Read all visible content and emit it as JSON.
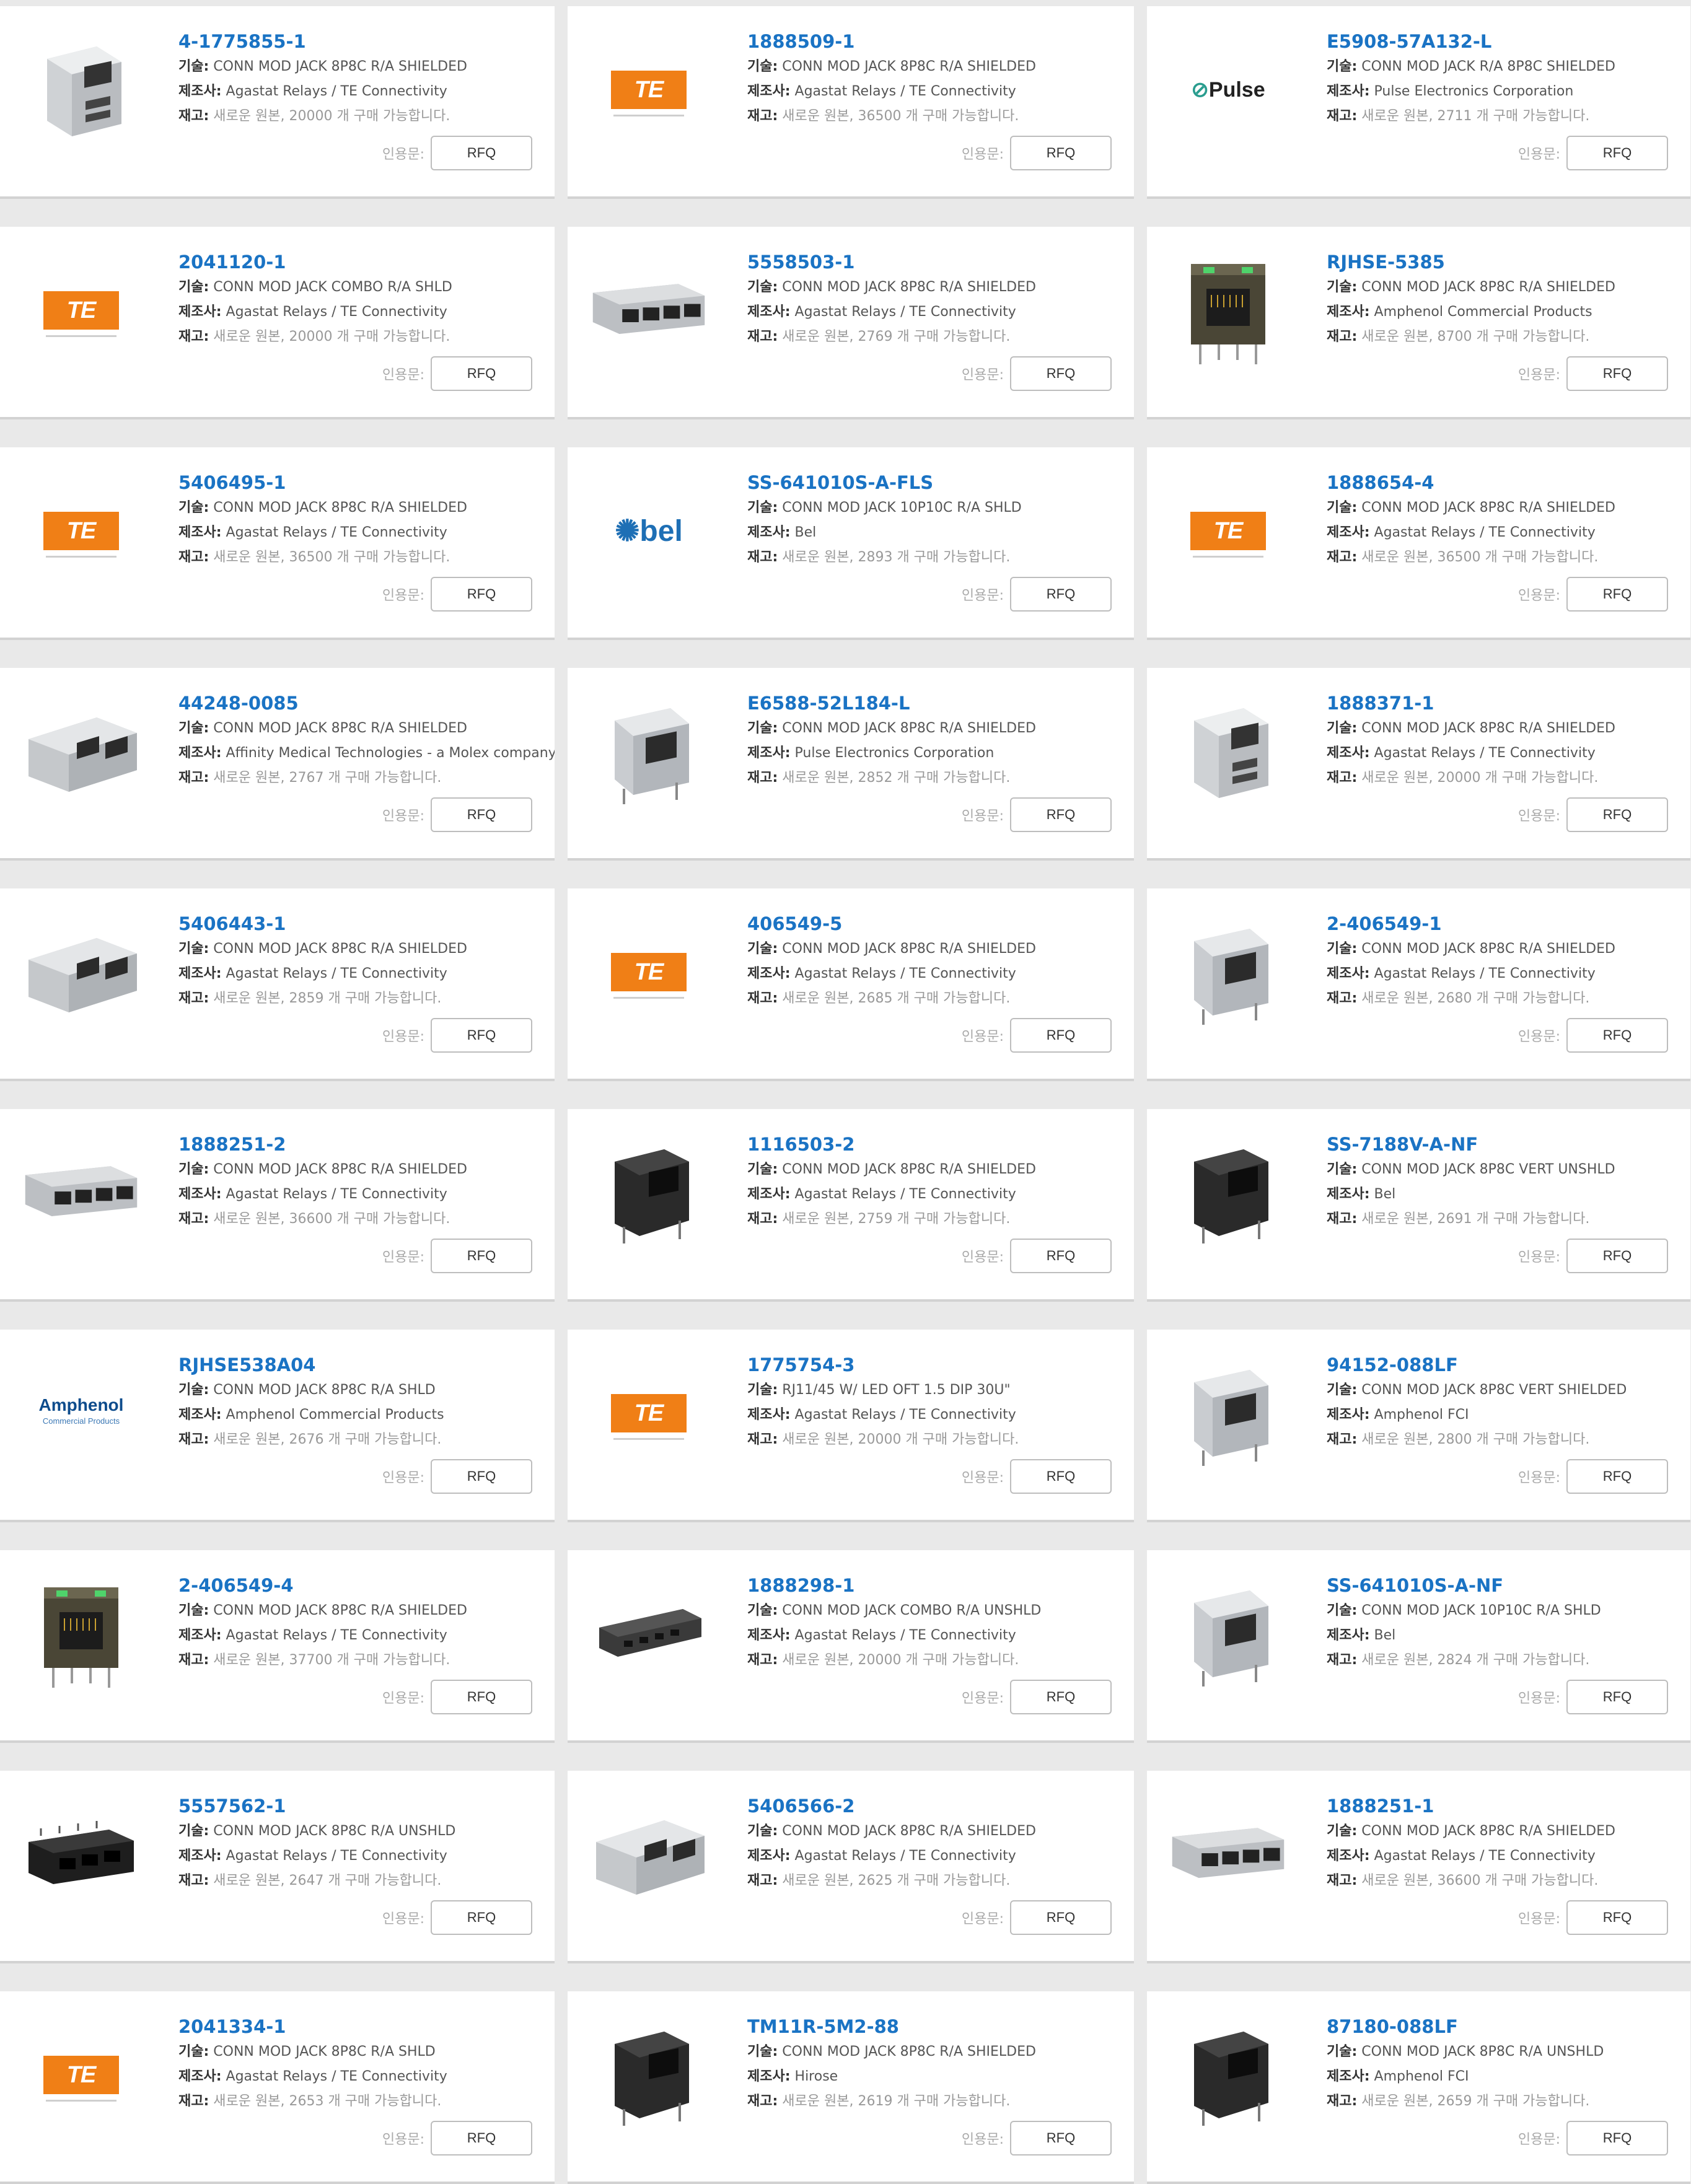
{
  "labels": {
    "desc": "기술:",
    "mfr": "제조사:",
    "stock": "재고:",
    "quote": "인용문:",
    "rfq": "RFQ"
  },
  "products": [
    {
      "pn": "4-1775855-1",
      "desc": "CONN MOD JACK 8P8C R/A SHIELDED",
      "mfr": "Agastat Relays / TE Connectivity",
      "stock": "새로운 원본, 20000 개 구매 가능합니다.",
      "image": "silver-jack-usb-image"
    },
    {
      "pn": "1888509-1",
      "desc": "CONN MOD JACK 8P8C R/A SHIELDED",
      "mfr": "Agastat Relays / TE Connectivity",
      "stock": "새로운 원본, 36500 개 구매 가능합니다.",
      "image": "te-logo"
    },
    {
      "pn": "E5908-57A132-L",
      "desc": "CONN MOD JACK R/A 8P8C SHIELDED",
      "mfr": "Pulse Electronics Corporation",
      "stock": "새로운 원본, 2711 개 구매 가능합니다.",
      "image": "pulse-logo"
    },
    {
      "pn": "2041120-1",
      "desc": "CONN MOD JACK COMBO R/A SHLD",
      "mfr": "Agastat Relays / TE Connectivity",
      "stock": "새로운 원본, 20000 개 구매 가능합니다.",
      "image": "te-logo"
    },
    {
      "pn": "5558503-1",
      "desc": "CONN MOD JACK 8P8C R/A SHIELDED",
      "mfr": "Agastat Relays / TE Connectivity",
      "stock": "새로운 원본, 2769 개 구매 가능합니다.",
      "image": "quad-jack-image"
    },
    {
      "pn": "RJHSE-5385",
      "desc": "CONN MOD JACK 8P8C R/A SHIELDED",
      "mfr": "Amphenol Commercial Products",
      "stock": "새로운 원본, 8700 개 구매 가능합니다.",
      "image": "dark-jack-led-image"
    },
    {
      "pn": "5406495-1",
      "desc": "CONN MOD JACK 8P8C R/A SHIELDED",
      "mfr": "Agastat Relays / TE Connectivity",
      "stock": "새로운 원본, 36500 개 구매 가능합니다.",
      "image": "te-logo"
    },
    {
      "pn": "SS-641010S-A-FLS",
      "desc": "CONN MOD JACK 10P10C R/A SHLD",
      "mfr": "Bel",
      "stock": "새로운 원본, 2893 개 구매 가능합니다.",
      "image": "bel-logo"
    },
    {
      "pn": "1888654-4",
      "desc": "CONN MOD JACK 8P8C R/A SHIELDED",
      "mfr": "Agastat Relays / TE Connectivity",
      "stock": "새로운 원본, 36500 개 구매 가능합니다.",
      "image": "te-logo"
    },
    {
      "pn": "44248-0085",
      "desc": "CONN MOD JACK 8P8C R/A SHIELDED",
      "mfr": "Affinity Medical Technologies - a Molex company",
      "stock": "새로운 원본, 2767 개 구매 가능합니다.",
      "image": "dual-jack-image"
    },
    {
      "pn": "E6588-52L184-L",
      "desc": "CONN MOD JACK 8P8C R/A SHIELDED",
      "mfr": "Pulse Electronics Corporation",
      "stock": "새로운 원본, 2852 개 구매 가능합니다.",
      "image": "silver-jack-image"
    },
    {
      "pn": "1888371-1",
      "desc": "CONN MOD JACK 8P8C R/A SHIELDED",
      "mfr": "Agastat Relays / TE Connectivity",
      "stock": "새로운 원본, 20000 개 구매 가능합니다.",
      "image": "silver-jack-usb-image"
    },
    {
      "pn": "5406443-1",
      "desc": "CONN MOD JACK 8P8C R/A SHIELDED",
      "mfr": "Agastat Relays / TE Connectivity",
      "stock": "새로운 원본, 2859 개 구매 가능합니다.",
      "image": "dual-jack-image"
    },
    {
      "pn": "406549-5",
      "desc": "CONN MOD JACK 8P8C R/A SHIELDED",
      "mfr": "Agastat Relays / TE Connectivity",
      "stock": "새로운 원본, 2685 개 구매 가능합니다.",
      "image": "te-logo"
    },
    {
      "pn": "2-406549-1",
      "desc": "CONN MOD JACK 8P8C R/A SHIELDED",
      "mfr": "Agastat Relays / TE Connectivity",
      "stock": "새로운 원본, 2680 개 구매 가능합니다.",
      "image": "silver-jack-image"
    },
    {
      "pn": "1888251-2",
      "desc": "CONN MOD JACK 8P8C R/A SHIELDED",
      "mfr": "Agastat Relays / TE Connectivity",
      "stock": "새로운 원본, 36600 개 구매 가능합니다.",
      "image": "quad-jack-image"
    },
    {
      "pn": "1116503-2",
      "desc": "CONN MOD JACK 8P8C R/A SHIELDED",
      "mfr": "Agastat Relays / TE Connectivity",
      "stock": "새로운 원본, 2759 개 구매 가능합니다.",
      "image": "black-jack-image"
    },
    {
      "pn": "SS-7188V-A-NF",
      "desc": "CONN MOD JACK 8P8C VERT UNSHLD",
      "mfr": "Bel",
      "stock": "새로운 원본, 2691 개 구매 가능합니다.",
      "image": "black-jack-image"
    },
    {
      "pn": "RJHSE538A04",
      "desc": "CONN MOD JACK 8P8C R/A SHLD",
      "mfr": "Amphenol Commercial Products",
      "stock": "새로운 원본, 2676 개 구매 가능합니다.",
      "image": "amphenol-logo"
    },
    {
      "pn": "1775754-3",
      "desc": "RJ11/45 W/ LED OFT 1.5 DIP 30U\"",
      "mfr": "Agastat Relays / TE Connectivity",
      "stock": "새로운 원본, 20000 개 구매 가능합니다.",
      "image": "te-logo"
    },
    {
      "pn": "94152-088LF",
      "desc": "CONN MOD JACK 8P8C VERT SHIELDED",
      "mfr": "Amphenol FCI",
      "stock": "새로운 원본, 2800 개 구매 가능합니다.",
      "image": "silver-jack-image"
    },
    {
      "pn": "2-406549-4",
      "desc": "CONN MOD JACK 8P8C R/A SHIELDED",
      "mfr": "Agastat Relays / TE Connectivity",
      "stock": "새로운 원본, 37700 개 구매 가능합니다.",
      "image": "dark-jack-led-image"
    },
    {
      "pn": "1888298-1",
      "desc": "CONN MOD JACK COMBO R/A UNSHLD",
      "mfr": "Agastat Relays / TE Connectivity",
      "stock": "새로운 원본, 20000 개 구매 가능합니다.",
      "image": "strip-jack-image"
    },
    {
      "pn": "SS-641010S-A-NF",
      "desc": "CONN MOD JACK 10P10C R/A SHLD",
      "mfr": "Bel",
      "stock": "새로운 원본, 2824 개 구매 가능합니다.",
      "image": "silver-jack-image"
    },
    {
      "pn": "5557562-1",
      "desc": "CONN MOD JACK 8P8C R/A UNSHLD",
      "mfr": "Agastat Relays / TE Connectivity",
      "stock": "새로운 원본, 2647 개 구매 가능합니다.",
      "image": "black-multi-jack-image"
    },
    {
      "pn": "5406566-2",
      "desc": "CONN MOD JACK 8P8C R/A SHIELDED",
      "mfr": "Agastat Relays / TE Connectivity",
      "stock": "새로운 원본, 2625 개 구매 가능합니다.",
      "image": "dual-jack-image"
    },
    {
      "pn": "1888251-1",
      "desc": "CONN MOD JACK 8P8C R/A SHIELDED",
      "mfr": "Agastat Relays / TE Connectivity",
      "stock": "새로운 원본, 36600 개 구매 가능합니다.",
      "image": "quad-jack-image"
    },
    {
      "pn": "2041334-1",
      "desc": "CONN MOD JACK 8P8C R/A SHLD",
      "mfr": "Agastat Relays / TE Connectivity",
      "stock": "새로운 원본, 2653 개 구매 가능합니다.",
      "image": "te-logo"
    },
    {
      "pn": "TM11R-5M2-88",
      "desc": "CONN MOD JACK 8P8C R/A SHIELDED",
      "mfr": "Hirose",
      "stock": "새로운 원본, 2619 개 구매 가능합니다.",
      "image": "black-jack-image"
    },
    {
      "pn": "87180-088LF",
      "desc": "CONN MOD JACK 8P8C R/A UNSHLD",
      "mfr": "Amphenol FCI",
      "stock": "새로운 원본, 2659 개 구매 가능합니다.",
      "image": "black-jack-image"
    }
  ],
  "logos": {
    "te": "TE",
    "pulse": "Pulse",
    "bel": "bel",
    "amphenol": "Amphenol",
    "amphenol_sub": "Commercial Products"
  },
  "colors": {
    "link": "#1a73c4",
    "te_orange": "#f07f16",
    "page_bg": "#e9e9e9"
  }
}
